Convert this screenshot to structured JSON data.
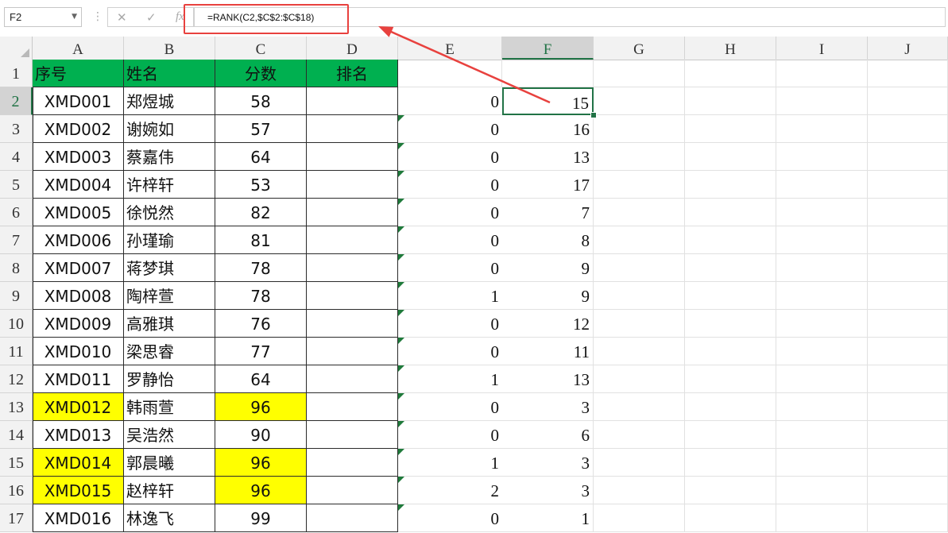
{
  "formula_bar": {
    "name_box": "F2",
    "cancel_icon": "✕",
    "enter_icon": "✓",
    "fx_label": "fx",
    "formula": "=RANK(C2,$C$2:$C$18)"
  },
  "columns": [
    "A",
    "B",
    "C",
    "D",
    "E",
    "F",
    "G",
    "H",
    "I",
    "J"
  ],
  "selected_column": "F",
  "selected_row": 2,
  "headers": {
    "A": "序号",
    "B": "姓名",
    "C": "分数",
    "D": "排名"
  },
  "rows": [
    {
      "row": 2,
      "id": "XMD001",
      "name": "郑煜城",
      "score": "58",
      "rank": "",
      "e": "0",
      "f": "15",
      "highlight": false
    },
    {
      "row": 3,
      "id": "XMD002",
      "name": "谢婉如",
      "score": "57",
      "rank": "",
      "e": "0",
      "f": "16",
      "highlight": false
    },
    {
      "row": 4,
      "id": "XMD003",
      "name": "蔡嘉伟",
      "score": "64",
      "rank": "",
      "e": "0",
      "f": "13",
      "highlight": false
    },
    {
      "row": 5,
      "id": "XMD004",
      "name": "许梓轩",
      "score": "53",
      "rank": "",
      "e": "0",
      "f": "17",
      "highlight": false
    },
    {
      "row": 6,
      "id": "XMD005",
      "name": "徐悦然",
      "score": "82",
      "rank": "",
      "e": "0",
      "f": "7",
      "highlight": false
    },
    {
      "row": 7,
      "id": "XMD006",
      "name": "孙瑾瑜",
      "score": "81",
      "rank": "",
      "e": "0",
      "f": "8",
      "highlight": false
    },
    {
      "row": 8,
      "id": "XMD007",
      "name": "蒋梦琪",
      "score": "78",
      "rank": "",
      "e": "0",
      "f": "9",
      "highlight": false
    },
    {
      "row": 9,
      "id": "XMD008",
      "name": "陶梓萱",
      "score": "78",
      "rank": "",
      "e": "1",
      "f": "9",
      "highlight": false
    },
    {
      "row": 10,
      "id": "XMD009",
      "name": "高雅琪",
      "score": "76",
      "rank": "",
      "e": "0",
      "f": "12",
      "highlight": false
    },
    {
      "row": 11,
      "id": "XMD010",
      "name": "梁思睿",
      "score": "77",
      "rank": "",
      "e": "0",
      "f": "11",
      "highlight": false
    },
    {
      "row": 12,
      "id": "XMD011",
      "name": "罗静怡",
      "score": "64",
      "rank": "",
      "e": "1",
      "f": "13",
      "highlight": false
    },
    {
      "row": 13,
      "id": "XMD012",
      "name": "韩雨萱",
      "score": "96",
      "rank": "",
      "e": "0",
      "f": "3",
      "highlight": true
    },
    {
      "row": 14,
      "id": "XMD013",
      "name": "吴浩然",
      "score": "90",
      "rank": "",
      "e": "0",
      "f": "6",
      "highlight": false
    },
    {
      "row": 15,
      "id": "XMD014",
      "name": "郭晨曦",
      "score": "96",
      "rank": "",
      "e": "1",
      "f": "3",
      "highlight": true
    },
    {
      "row": 16,
      "id": "XMD015",
      "name": "赵梓轩",
      "score": "96",
      "rank": "",
      "e": "2",
      "f": "3",
      "highlight": true
    },
    {
      "row": 17,
      "id": "XMD016",
      "name": "林逸飞",
      "score": "99",
      "rank": "",
      "e": "0",
      "f": "1",
      "highlight": false
    }
  ],
  "colors": {
    "header_fill": "#00b050",
    "highlight_fill": "#ffff00",
    "selection": "#217346",
    "annotation": "#e8413e"
  }
}
